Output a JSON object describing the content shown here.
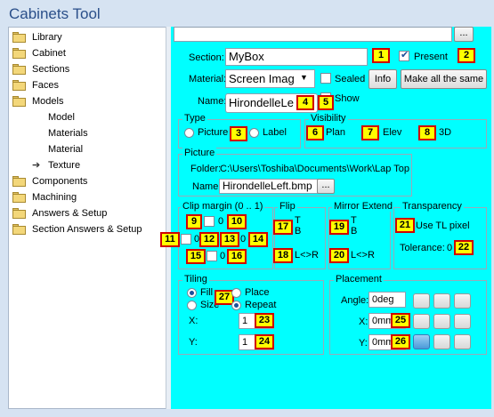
{
  "window": {
    "title": "Cabinets Tool"
  },
  "tree": {
    "items": [
      {
        "label": "Library",
        "icon": "folder-icon"
      },
      {
        "label": "Cabinet",
        "icon": "folder-icon"
      },
      {
        "label": "Sections",
        "icon": "folder-icon"
      },
      {
        "label": "Faces",
        "icon": "folder-icon"
      },
      {
        "label": "Models",
        "icon": "folder-icon"
      },
      {
        "label": "Model"
      },
      {
        "label": "Materials"
      },
      {
        "label": "Material"
      },
      {
        "label": "Texture",
        "icon": "arrow-right-icon"
      },
      {
        "label": "Components",
        "icon": "folder-icon"
      },
      {
        "label": "Machining",
        "icon": "folder-icon"
      },
      {
        "label": "Answers & Setup",
        "icon": "folder-icon"
      },
      {
        "label": "Section Answers & Setup",
        "icon": "folder-icon"
      }
    ]
  },
  "top": {
    "browse_label": "..."
  },
  "section": {
    "label": "Section:",
    "value": "MyBox",
    "present_label": "Present"
  },
  "material": {
    "label": "Material:",
    "value": "Screen Imag",
    "sealed_label": "Sealed",
    "info_label": "Info",
    "same_label": "Make all the same"
  },
  "name": {
    "label": "Name:",
    "value": "HirondelleLe",
    "show_label": "Show"
  },
  "type": {
    "title": "Type",
    "picture_label": "Picture",
    "label_label": "Label"
  },
  "visibility": {
    "title": "Visibility",
    "plan_label": "Plan",
    "elev_label": "Elev",
    "3d_label": "3D"
  },
  "picture": {
    "title": "Picture",
    "folder_label": "Folder:",
    "folder_value": "C:\\Users\\Toshiba\\Documents\\Work\\Lap Top",
    "name_label": "Name:",
    "name_value": "HirondelleLeft.bmp",
    "browse_label": "..."
  },
  "clip": {
    "title": "Clip margin (0 .. 1)",
    "v1": "0",
    "v2": "0",
    "v3": "0",
    "v4": "0"
  },
  "flip": {
    "title": "Flip",
    "t": "T",
    "b": "B",
    "lr": "L<>R"
  },
  "mirror": {
    "title": "Mirror Extend",
    "t": "T",
    "b": "B",
    "lr": "L<>R"
  },
  "transparency": {
    "title": "Transparency",
    "use_label": "Use TL pixel",
    "tol_label": "Tolerance:",
    "tol_value": "0"
  },
  "tiling": {
    "title": "Tiling",
    "fill_label": "Fill",
    "size_label": "Size",
    "place_label": "Place",
    "repeat_label": "Repeat",
    "x_label": "X:",
    "x_value": "1",
    "y_label": "Y:",
    "y_value": "1"
  },
  "placement": {
    "title": "Placement",
    "angle_label": "Angle:",
    "angle_value": "0deg",
    "x_label": "X:",
    "x_value": "0mm",
    "y_label": "Y:",
    "y_value": "0mm"
  },
  "badges": [
    "1",
    "2",
    "3",
    "4",
    "5",
    "6",
    "7",
    "8",
    "9",
    "10",
    "11",
    "12",
    "13",
    "14",
    "15",
    "16",
    "17",
    "18",
    "19",
    "20",
    "21",
    "22",
    "23",
    "24",
    "25",
    "26",
    "27"
  ],
  "colors": {
    "panel": "#00ffff",
    "badge_fill": "#ffff00",
    "badge_border": "#d00000",
    "title": "#2a4f8a"
  }
}
